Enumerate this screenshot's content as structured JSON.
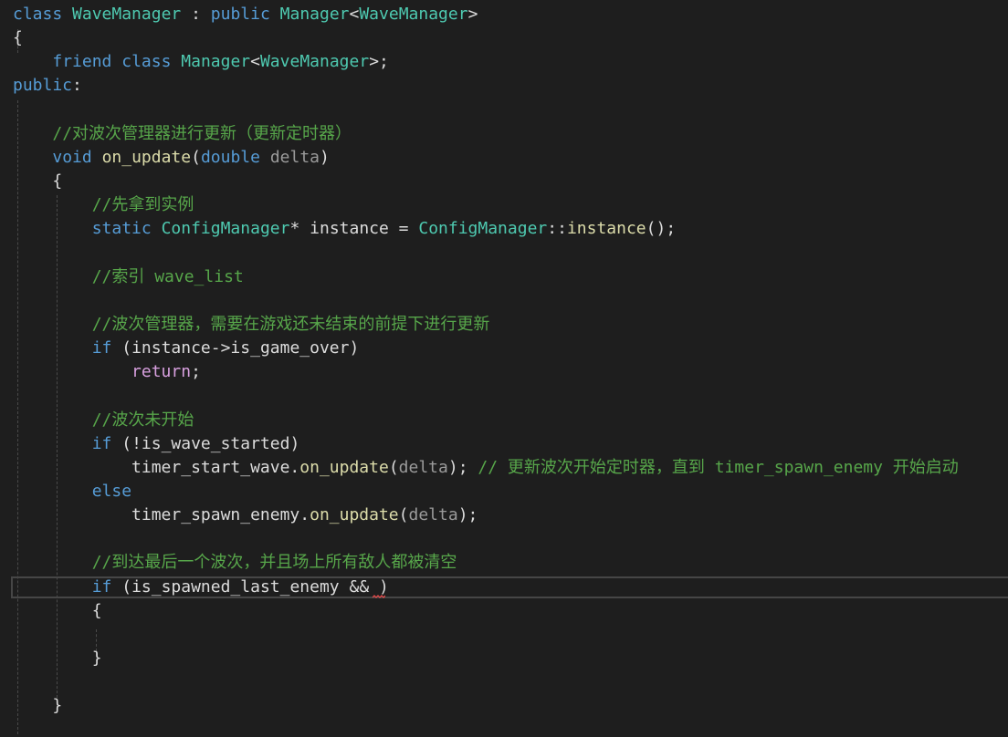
{
  "editor": {
    "lines": [
      {
        "parts": [
          {
            "cls": "kw",
            "text": "class"
          },
          {
            "cls": "id",
            "text": " "
          },
          {
            "cls": "ty",
            "text": "WaveManager"
          },
          {
            "cls": "id",
            "text": " : "
          },
          {
            "cls": "kw",
            "text": "public"
          },
          {
            "cls": "id",
            "text": " "
          },
          {
            "cls": "ty",
            "text": "Manager"
          },
          {
            "cls": "id",
            "text": "<"
          },
          {
            "cls": "ty",
            "text": "WaveManager"
          },
          {
            "cls": "id",
            "text": ">"
          }
        ]
      },
      {
        "parts": [
          {
            "cls": "id",
            "text": "{"
          }
        ]
      },
      {
        "parts": [
          {
            "cls": "id",
            "text": "    "
          },
          {
            "cls": "kw",
            "text": "friend"
          },
          {
            "cls": "id",
            "text": " "
          },
          {
            "cls": "kw",
            "text": "class"
          },
          {
            "cls": "id",
            "text": " "
          },
          {
            "cls": "ty",
            "text": "Manager"
          },
          {
            "cls": "id",
            "text": "<"
          },
          {
            "cls": "ty",
            "text": "WaveManager"
          },
          {
            "cls": "id",
            "text": ">;"
          }
        ]
      },
      {
        "parts": [
          {
            "cls": "kw",
            "text": "public"
          },
          {
            "cls": "id",
            "text": ":"
          }
        ]
      },
      {
        "parts": []
      },
      {
        "parts": [
          {
            "cls": "id",
            "text": "    "
          },
          {
            "cls": "cm",
            "text": "//对波次管理器进行更新（更新定时器）"
          }
        ]
      },
      {
        "parts": [
          {
            "cls": "id",
            "text": "    "
          },
          {
            "cls": "kw",
            "text": "void"
          },
          {
            "cls": "id",
            "text": " "
          },
          {
            "cls": "fn",
            "text": "on_update"
          },
          {
            "cls": "id",
            "text": "("
          },
          {
            "cls": "kw",
            "text": "double"
          },
          {
            "cls": "id",
            "text": " "
          },
          {
            "cls": "pm",
            "text": "delta"
          },
          {
            "cls": "id",
            "text": ")"
          }
        ]
      },
      {
        "parts": [
          {
            "cls": "id",
            "text": "    {"
          }
        ]
      },
      {
        "parts": [
          {
            "cls": "id",
            "text": "        "
          },
          {
            "cls": "cm",
            "text": "//先拿到实例"
          }
        ]
      },
      {
        "parts": [
          {
            "cls": "id",
            "text": "        "
          },
          {
            "cls": "kw",
            "text": "static"
          },
          {
            "cls": "id",
            "text": " "
          },
          {
            "cls": "ty",
            "text": "ConfigManager"
          },
          {
            "cls": "id",
            "text": "* instance = "
          },
          {
            "cls": "ty",
            "text": "ConfigManager"
          },
          {
            "cls": "id",
            "text": "::"
          },
          {
            "cls": "fn",
            "text": "instance"
          },
          {
            "cls": "id",
            "text": "();"
          }
        ]
      },
      {
        "parts": []
      },
      {
        "parts": [
          {
            "cls": "id",
            "text": "        "
          },
          {
            "cls": "cm",
            "text": "//索引 wave_list"
          }
        ]
      },
      {
        "parts": []
      },
      {
        "parts": [
          {
            "cls": "id",
            "text": "        "
          },
          {
            "cls": "cm",
            "text": "//波次管理器，需要在游戏还未结束的前提下进行更新"
          }
        ]
      },
      {
        "parts": [
          {
            "cls": "id",
            "text": "        "
          },
          {
            "cls": "kw",
            "text": "if"
          },
          {
            "cls": "id",
            "text": " (instance->is_game_over)"
          }
        ]
      },
      {
        "parts": [
          {
            "cls": "id",
            "text": "            "
          },
          {
            "cls": "fl",
            "text": "return"
          },
          {
            "cls": "id",
            "text": ";"
          }
        ]
      },
      {
        "parts": []
      },
      {
        "parts": [
          {
            "cls": "id",
            "text": "        "
          },
          {
            "cls": "cm",
            "text": "//波次未开始"
          }
        ]
      },
      {
        "parts": [
          {
            "cls": "id",
            "text": "        "
          },
          {
            "cls": "kw",
            "text": "if"
          },
          {
            "cls": "id",
            "text": " (!is_wave_started)"
          }
        ]
      },
      {
        "parts": [
          {
            "cls": "id",
            "text": "            timer_start_wave."
          },
          {
            "cls": "fn",
            "text": "on_update"
          },
          {
            "cls": "id",
            "text": "("
          },
          {
            "cls": "pm",
            "text": "delta"
          },
          {
            "cls": "id",
            "text": "); "
          },
          {
            "cls": "cm",
            "text": "// 更新波次开始定时器，直到 timer_spawn_enemy 开始启动"
          }
        ]
      },
      {
        "parts": [
          {
            "cls": "id",
            "text": "        "
          },
          {
            "cls": "kw",
            "text": "else"
          }
        ]
      },
      {
        "parts": [
          {
            "cls": "id",
            "text": "            timer_spawn_enemy."
          },
          {
            "cls": "fn",
            "text": "on_update"
          },
          {
            "cls": "id",
            "text": "("
          },
          {
            "cls": "pm",
            "text": "delta"
          },
          {
            "cls": "id",
            "text": ");"
          }
        ]
      },
      {
        "parts": []
      },
      {
        "parts": [
          {
            "cls": "id",
            "text": "        "
          },
          {
            "cls": "cm",
            "text": "//到达最后一个波次，并且场上所有敌人都被清空"
          }
        ]
      },
      {
        "parts": [
          {
            "cls": "id",
            "text": "        "
          },
          {
            "cls": "kw",
            "text": "if"
          },
          {
            "cls": "id",
            "text": " (is_spawned_last_enemy && )"
          }
        ]
      },
      {
        "parts": [
          {
            "cls": "id",
            "text": "        {"
          }
        ]
      },
      {
        "parts": []
      },
      {
        "parts": [
          {
            "cls": "id",
            "text": "        }"
          }
        ]
      },
      {
        "parts": []
      },
      {
        "parts": [
          {
            "cls": "id",
            "text": "    }"
          }
        ]
      }
    ]
  },
  "colors": {
    "background": "#1e1e1e",
    "keyword": "#569cd6",
    "type": "#4ec9b0",
    "function": "#dcdcaa",
    "parameter": "#9a9a9a",
    "comment": "#57a64a",
    "identifier": "#dcdcdc",
    "control_flow": "#d8a0df",
    "error_squiggle": "#f14c4c"
  }
}
